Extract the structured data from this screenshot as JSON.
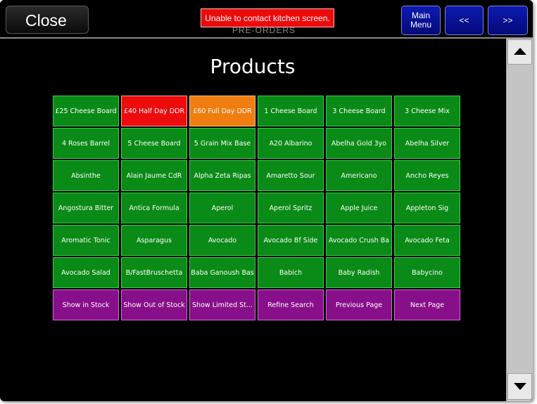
{
  "header": {
    "close_label": "Close",
    "alert_text": "Unable to contact kitchen screen.",
    "obscured_title": "PRE-ORDERS",
    "main_menu_label": "Main\nMenu",
    "prev_label": "<<",
    "next_label": ">>"
  },
  "main": {
    "title": "Products"
  },
  "colors": {
    "product": "#0a8a16",
    "highlight_red": "#ee0b0b",
    "highlight_orange": "#f07d10",
    "action": "#880f8a",
    "nav_blue": "#0d1ab0",
    "alert_red": "#ec0a0a"
  },
  "products": [
    {
      "label": "£25 Cheese Board",
      "color": "green"
    },
    {
      "label": "£40 Half Day DDR",
      "color": "red"
    },
    {
      "label": "£60 Full Day DDR",
      "color": "orange"
    },
    {
      "label": "1 Cheese Board",
      "color": "green"
    },
    {
      "label": "3 Cheese Board",
      "color": "green"
    },
    {
      "label": "3 Cheese Mix",
      "color": "green"
    },
    {
      "label": "4 Roses Barrel",
      "color": "green"
    },
    {
      "label": "5 Cheese Board",
      "color": "green"
    },
    {
      "label": "5 Grain Mix Base",
      "color": "green"
    },
    {
      "label": "A20 Albarino",
      "color": "green"
    },
    {
      "label": "Abelha Gold 3yo",
      "color": "green"
    },
    {
      "label": "Abelha Silver",
      "color": "green"
    },
    {
      "label": "Absinthe",
      "color": "green"
    },
    {
      "label": "Alain Jaume CdR",
      "color": "green"
    },
    {
      "label": "Alpha Zeta Ripas",
      "color": "green"
    },
    {
      "label": "Amaretto Sour",
      "color": "green"
    },
    {
      "label": "Americano",
      "color": "green"
    },
    {
      "label": "Ancho Reyes",
      "color": "green"
    },
    {
      "label": "Angostura Bitter",
      "color": "green"
    },
    {
      "label": "Antica Formula",
      "color": "green"
    },
    {
      "label": "Aperol",
      "color": "green"
    },
    {
      "label": "Aperol Spritz",
      "color": "green"
    },
    {
      "label": "Apple Juice",
      "color": "green"
    },
    {
      "label": "Appleton Sig",
      "color": "green"
    },
    {
      "label": "Aromatic Tonic",
      "color": "green"
    },
    {
      "label": "Asparagus",
      "color": "green"
    },
    {
      "label": "Avocado",
      "color": "green"
    },
    {
      "label": "Avocado Bf Side",
      "color": "green"
    },
    {
      "label": "Avocado Crush Ba",
      "color": "green"
    },
    {
      "label": "Avocado Feta",
      "color": "green"
    },
    {
      "label": "Avocado Salad",
      "color": "green"
    },
    {
      "label": "B/FastBruschetta",
      "color": "green"
    },
    {
      "label": "Baba Ganoush Bas",
      "color": "green"
    },
    {
      "label": "Babich",
      "color": "green"
    },
    {
      "label": "Baby Radish",
      "color": "green"
    },
    {
      "label": "Babycino",
      "color": "green"
    }
  ],
  "actions": [
    {
      "label": "Show in Stock"
    },
    {
      "label": "Show Out of Stock"
    },
    {
      "label": "Show Limited St..."
    },
    {
      "label": "Refine Search"
    },
    {
      "label": "Previous Page"
    },
    {
      "label": "Next Page"
    }
  ],
  "scrollbar": {
    "up_icon": "triangle-up",
    "down_icon": "triangle-down"
  }
}
